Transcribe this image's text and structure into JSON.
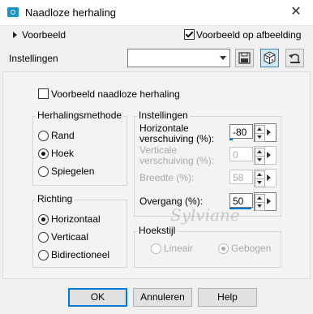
{
  "window": {
    "title": "Naadloze herhaling"
  },
  "preview": {
    "label": "Voorbeeld",
    "checkbox_label": "Voorbeeld op afbeelding",
    "checked": true
  },
  "settings_row": {
    "label": "Instellingen",
    "preset_value": ""
  },
  "main": {
    "seamless_preview_label": "Voorbeeld naadloze herhaling",
    "seamless_preview_checked": false,
    "method_group": {
      "title": "Herhalingsmethode",
      "options": [
        "Rand",
        "Hoek",
        "Spiegelen"
      ],
      "selected": "Hoek"
    },
    "direction_group": {
      "title": "Richting",
      "options": [
        "Horizontaal",
        "Verticaal",
        "Bidirectioneel"
      ],
      "selected": "Horizontaal"
    },
    "settings_group": {
      "title": "Instellingen",
      "horizontal_label": "Horizontale verschuiving (%):",
      "horizontal_value": "-80",
      "vertical_label": "Verticale verschuiving (%):",
      "vertical_value": "0",
      "width_label": "Breedte (%):",
      "width_value": "58",
      "transition_label": "Overgang (%):",
      "transition_value": "50"
    },
    "corner_group": {
      "title": "Hoekstijl",
      "options": [
        "Lineair",
        "Gebogen"
      ],
      "selected": "Gebogen"
    }
  },
  "watermark": {
    "text": "Sylviane"
  },
  "buttons": {
    "ok": "OK",
    "cancel": "Annuleren",
    "help": "Help"
  }
}
